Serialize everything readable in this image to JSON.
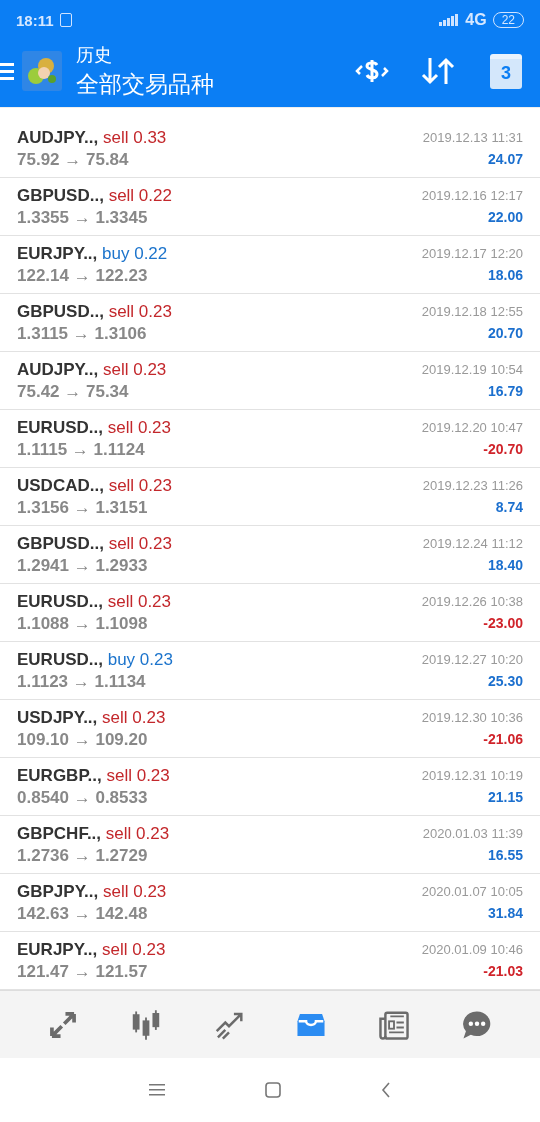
{
  "status_bar": {
    "time": "18:11",
    "network": "4G",
    "battery": "22"
  },
  "header": {
    "title": "历史",
    "subtitle": "全部交易品种",
    "calendar_day": "3"
  },
  "trades": [
    {
      "symbol": "AUDJPY..,",
      "side": "sell",
      "volume": "0.33",
      "prices": "75.92 → 75.84",
      "time": "2019.12.13 11:31",
      "profit": "24.07",
      "loss": false
    },
    {
      "symbol": "GBPUSD..,",
      "side": "sell",
      "volume": "0.22",
      "prices": "1.3355 → 1.3345",
      "time": "2019.12.16 12:17",
      "profit": "22.00",
      "loss": false
    },
    {
      "symbol": "EURJPY..,",
      "side": "buy",
      "volume": "0.22",
      "prices": "122.14 → 122.23",
      "time": "2019.12.17 12:20",
      "profit": "18.06",
      "loss": false
    },
    {
      "symbol": "GBPUSD..,",
      "side": "sell",
      "volume": "0.23",
      "prices": "1.3115 → 1.3106",
      "time": "2019.12.18 12:55",
      "profit": "20.70",
      "loss": false
    },
    {
      "symbol": "AUDJPY..,",
      "side": "sell",
      "volume": "0.23",
      "prices": "75.42 → 75.34",
      "time": "2019.12.19 10:54",
      "profit": "16.79",
      "loss": false
    },
    {
      "symbol": "EURUSD..,",
      "side": "sell",
      "volume": "0.23",
      "prices": "1.1115 → 1.1124",
      "time": "2019.12.20 10:47",
      "profit": "-20.70",
      "loss": true
    },
    {
      "symbol": "USDCAD..,",
      "side": "sell",
      "volume": "0.23",
      "prices": "1.3156 → 1.3151",
      "time": "2019.12.23 11:26",
      "profit": "8.74",
      "loss": false
    },
    {
      "symbol": "GBPUSD..,",
      "side": "sell",
      "volume": "0.23",
      "prices": "1.2941 → 1.2933",
      "time": "2019.12.24 11:12",
      "profit": "18.40",
      "loss": false
    },
    {
      "symbol": "EURUSD..,",
      "side": "sell",
      "volume": "0.23",
      "prices": "1.1088 → 1.1098",
      "time": "2019.12.26 10:38",
      "profit": "-23.00",
      "loss": true
    },
    {
      "symbol": "EURUSD..,",
      "side": "buy",
      "volume": "0.23",
      "prices": "1.1123 → 1.1134",
      "time": "2019.12.27 10:20",
      "profit": "25.30",
      "loss": false
    },
    {
      "symbol": "USDJPY..,",
      "side": "sell",
      "volume": "0.23",
      "prices": "109.10 → 109.20",
      "time": "2019.12.30 10:36",
      "profit": "-21.06",
      "loss": true
    },
    {
      "symbol": "EURGBP..,",
      "side": "sell",
      "volume": "0.23",
      "prices": "0.8540 → 0.8533",
      "time": "2019.12.31 10:19",
      "profit": "21.15",
      "loss": false
    },
    {
      "symbol": "GBPCHF..,",
      "side": "sell",
      "volume": "0.23",
      "prices": "1.2736 → 1.2729",
      "time": "2020.01.03 11:39",
      "profit": "16.55",
      "loss": false
    },
    {
      "symbol": "GBPJPY..,",
      "side": "sell",
      "volume": "0.23",
      "prices": "142.63 → 142.48",
      "time": "2020.01.07 10:05",
      "profit": "31.84",
      "loss": false
    },
    {
      "symbol": "EURJPY..,",
      "side": "sell",
      "volume": "0.23",
      "prices": "121.47 → 121.57",
      "time": "2020.01.09 10:46",
      "profit": "-21.03",
      "loss": true
    }
  ],
  "bottom_nav": [
    {
      "kind": "quotes",
      "selected": false
    },
    {
      "kind": "chart",
      "selected": false
    },
    {
      "kind": "trade",
      "selected": false
    },
    {
      "kind": "history",
      "selected": true
    },
    {
      "kind": "news",
      "selected": false
    },
    {
      "kind": "chat",
      "selected": false
    }
  ]
}
